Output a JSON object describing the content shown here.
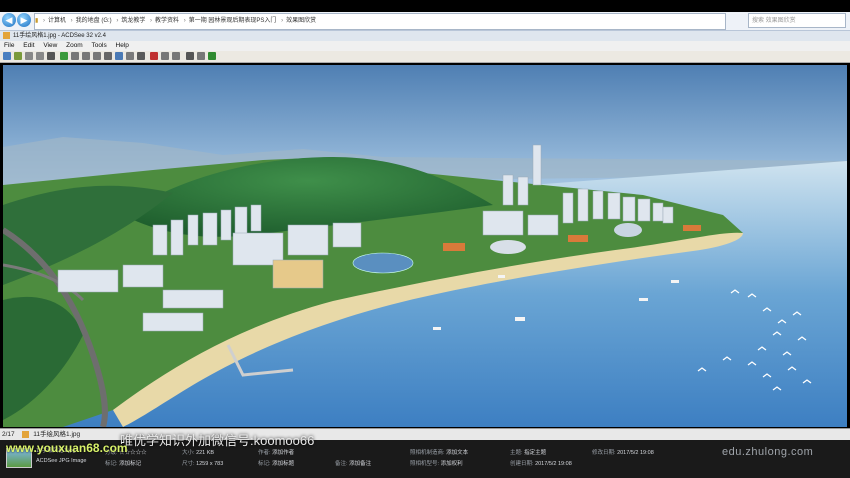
{
  "explorer": {
    "breadcrumbs": [
      "计算机",
      "我的地盘 (G:)",
      "筑龙教学",
      "教学资料",
      "第一期 园林景观后期表现PS入门",
      "效果图欣赏"
    ],
    "search_placeholder": "搜索 效果图欣赏"
  },
  "app": {
    "title": "11手绘风格1.jpg - ACDSee 32 v2.4",
    "menu": [
      "File",
      "Edit",
      "View",
      "Zoom",
      "Tools",
      "Help"
    ]
  },
  "status": {
    "page_counter": "2/17",
    "filename": "11手绘风格1.jpg"
  },
  "info": {
    "file_name_short": "11手绘风格1.jpg",
    "file_type": "ACDSee JPG Image",
    "rating_label": "分级:",
    "tag_label": "标记:",
    "tag_value": "添加标记",
    "size_label": "大小:",
    "size_value": "221 KB",
    "dims_label": "尺寸:",
    "dims_value": "1259 x 783",
    "author_label": "作者:",
    "author_value": "添加作者",
    "keywords_label": "标记:",
    "keywords_value": "添加标题",
    "notes_label": "备注:",
    "notes_value": "添加备注",
    "comment_label": "照相机制造商:",
    "comment_value": "添加文本",
    "camera_label": "照相机型号:",
    "camera_value": "添加权利",
    "subject_label": "主题:",
    "subject_value": "指定主题",
    "created_label": "创建日期:",
    "created_value": "2017/5/2 19:08",
    "modified_label": "修改日期:",
    "modified_value": "2017/5/2 19:08"
  },
  "overlays": {
    "watermark_site": "www.youxuan68.com",
    "watermark_text": "唯优学知识外加微信号:koomoo66",
    "logo": "edu.zhulong.com"
  }
}
